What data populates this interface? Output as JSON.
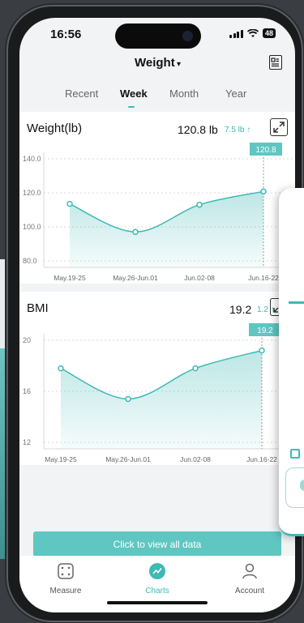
{
  "status_bar": {
    "time": "16:56",
    "battery": "48"
  },
  "header": {
    "title": "Weight",
    "caret": "▾",
    "icon": "report-icon"
  },
  "tabs": [
    {
      "label": "Recent",
      "active": false
    },
    {
      "label": "Week",
      "active": true
    },
    {
      "label": "Month",
      "active": false
    },
    {
      "label": "Year",
      "active": false
    }
  ],
  "weight_card": {
    "title": "Weight(lb)",
    "value": "120.8 lb",
    "delta": "7.5 lb ↑",
    "tooltip": "120.8",
    "expand_icon": "expand-icon"
  },
  "bmi_card": {
    "title": "BMI",
    "value": "19.2",
    "delta": "1.2 ↑",
    "tooltip": "19.2",
    "expand_icon": "expand-icon"
  },
  "chart_data": [
    {
      "type": "area",
      "title": "Weight(lb)",
      "categories": [
        "May.19-25",
        "May.26-Jun.01",
        "Jun.02-08",
        "Jun.16-22"
      ],
      "x_tick_labels": [
        "May.19-25",
        "May.26-Jun.01",
        "Jun.02-08",
        "Jun.16-22"
      ],
      "y_tick_labels": [
        "140.0",
        "120.0",
        "100.0",
        "80.0"
      ],
      "values": [
        113.5,
        97,
        113,
        120.8
      ],
      "ylim": [
        80,
        140
      ],
      "highlight": "120.8",
      "grid": true,
      "color": "#3fb9b5"
    },
    {
      "type": "area",
      "title": "BMI",
      "categories": [
        "May.19-25",
        "May.26-Jun.01",
        "Jun.02-08",
        "Jun.16-22"
      ],
      "x_tick_labels": [
        "May.19-25",
        "May.26-Jun.01",
        "Jun.02-08",
        "Jun.16-22"
      ],
      "y_tick_labels": [
        "20",
        "16",
        "12"
      ],
      "values": [
        17.8,
        15.4,
        17.8,
        19.2
      ],
      "ylim": [
        12,
        20
      ],
      "highlight": "19.2",
      "grid": true,
      "color": "#3fb9b5"
    }
  ],
  "view_all_button": "Click to view all data",
  "nav": [
    {
      "label": "Measure",
      "icon": "measure-icon",
      "active": false
    },
    {
      "label": "Charts",
      "icon": "charts-icon",
      "active": true
    },
    {
      "label": "Account",
      "icon": "account-icon",
      "active": false
    }
  ],
  "colors": {
    "accent": "#3fb9b5",
    "button": "#5fc6c2"
  }
}
